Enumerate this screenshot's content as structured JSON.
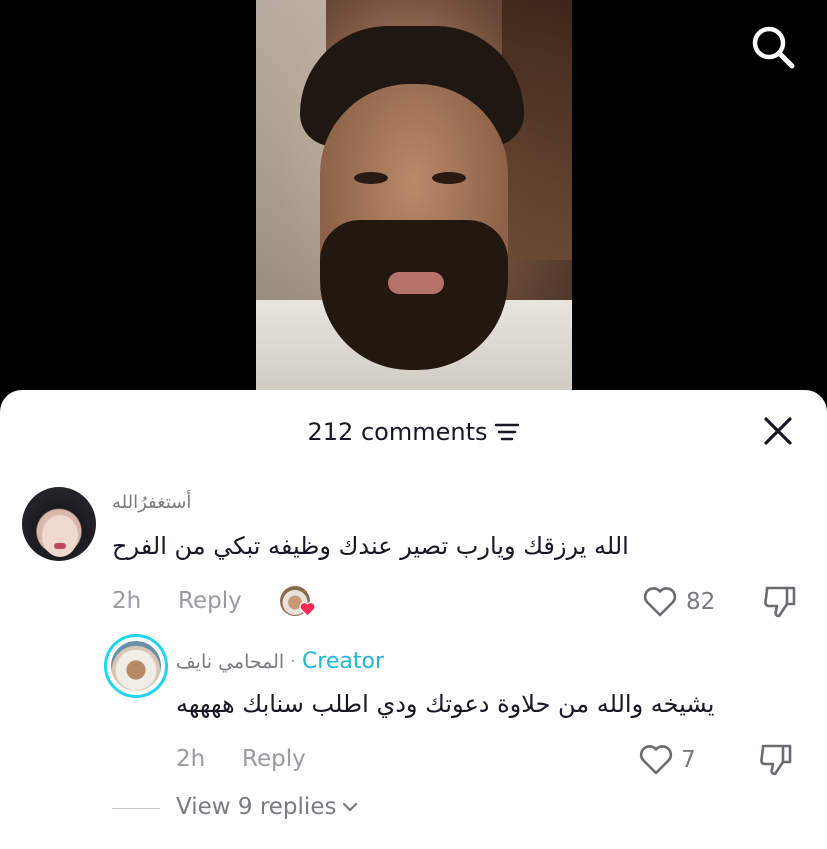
{
  "header": {
    "title": "212 comments"
  },
  "comments": [
    {
      "username": "أستغفرُالله",
      "text": "الله يرزقك ويارب تصير عندك وظيفه تبكي من الفرح",
      "time": "2h",
      "reply_label": "Reply",
      "likes": "82"
    },
    {
      "username": "المحامي نايف",
      "badge": "Creator",
      "text": "يشيخه والله من حلاوة دعوتك ودي اطلب سنابك ههههه",
      "time": "2h",
      "reply_label": "Reply",
      "likes": "7"
    }
  ],
  "view_replies": "View 9 replies",
  "colors": {
    "creator": "#20b8cf",
    "avatar_ring": "#20d5ec",
    "like_heart_badge": "#fe2c55"
  },
  "icons": [
    "search-icon",
    "sort-icon",
    "close-icon",
    "heart-icon",
    "dislike-icon",
    "chevron-down-icon"
  ]
}
